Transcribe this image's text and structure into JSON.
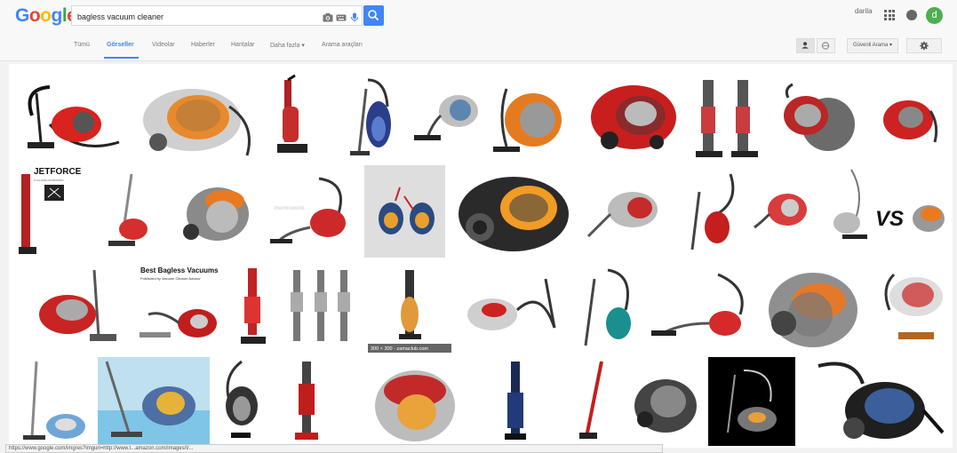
{
  "header": {
    "logo_letters": [
      "G",
      "o",
      "o",
      "g",
      "l",
      "e"
    ],
    "logo_colors": [
      "#4285f4",
      "#ea4335",
      "#fbbc05",
      "#4285f4",
      "#34a853",
      "#ea4335"
    ],
    "search_value": "bagless vacuum cleaner",
    "user_name": "darila",
    "avatar_letter": "d"
  },
  "tabs": [
    {
      "label": "Tümü",
      "active": false
    },
    {
      "label": "Görseller",
      "active": true
    },
    {
      "label": "Videolar",
      "active": false
    },
    {
      "label": "Haberler",
      "active": false
    },
    {
      "label": "Haritalar",
      "active": false
    },
    {
      "label": "Daha fazla ▾",
      "active": false
    },
    {
      "label": "Arama araçları",
      "active": false
    }
  ],
  "controls": {
    "safe_search_label": "Güvenli Arama ▾"
  },
  "overlays": {
    "jetforce": "JETFORCE",
    "jetforce_sub": "CYCLONIC FILTRATION",
    "vs": "VS",
    "best_title": "Best Bagless Vacuums",
    "best_sub": "Published by Vacuum Cleaner Advisor",
    "size_caption": "300 × 300 - zamaclub.com",
    "watermark": "thermoworld"
  },
  "status_url": "https://www.google.com/imgres?imgurl=http://www.t...amazon.com/images/I/..."
}
